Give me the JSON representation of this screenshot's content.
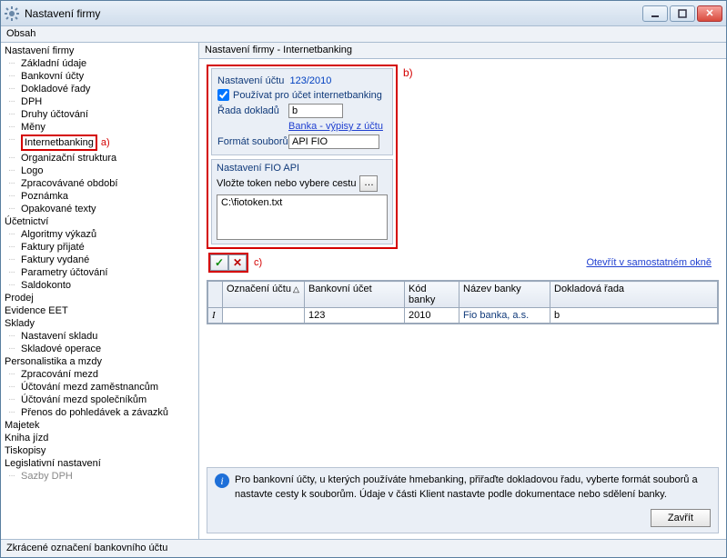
{
  "window": {
    "title": "Nastavení firmy"
  },
  "menu": {
    "obsah": "Obsah"
  },
  "breadcrumb": "Nastavení firmy - Internetbanking",
  "annotations": {
    "a": "a)",
    "b": "b)",
    "c": "c)"
  },
  "tree": {
    "root1": "Nastavení firmy",
    "r1": [
      "Základní údaje",
      "Bankovní účty",
      "Dokladové řady",
      "DPH",
      "Druhy účtování",
      "Měny",
      "Internetbanking",
      "Organizační struktura",
      "Logo",
      "Zpracovávané období",
      "Poznámka",
      "Opakované texty"
    ],
    "root2": "Účetnictví",
    "r2": [
      "Algoritmy výkazů",
      "Faktury přijaté",
      "Faktury vydané",
      "Parametry účtování",
      "Saldokonto"
    ],
    "root3": "Prodej",
    "root4": "Evidence EET",
    "root5": "Sklady",
    "r5": [
      "Nastavení skladu",
      "Skladové operace"
    ],
    "root6": "Personalistika a mzdy",
    "r6": [
      "Zpracování mezd",
      "Účtování mezd zaměstnancům",
      "Účtování mezd společníkům",
      "Přenos do pohledávek a závazků"
    ],
    "root7": "Majetek",
    "root8": "Kniha jízd",
    "root9": "Tiskopisy",
    "root10": "Legislativní nastavení",
    "r10_cut": "Sazby DPH"
  },
  "settings": {
    "grouptitle": "Nastavení účtu",
    "account": "123/2010",
    "chk_label": "Používat pro účet internetbanking",
    "rada_label": "Řada dokladů",
    "rada_value": "b",
    "banka_link": "Banka - výpisy z účtu",
    "format_label": "Formát souborů",
    "format_value": "API FIO"
  },
  "fio": {
    "title": "Nastavení FIO API",
    "hint": "Vložte token nebo vybere cestu",
    "path": "C:\\fiotoken.txt"
  },
  "openlink": "Otevřít v samostatném okně",
  "grid": {
    "headers": [
      "Označení účtu",
      "Bankovní účet",
      "Kód banky",
      "Název banky",
      "Dokladová řada"
    ],
    "row": [
      "",
      "123",
      "2010",
      "Fio banka, a.s.",
      "b"
    ]
  },
  "info": {
    "text": "Pro bankovní účty, u kterých používáte hmebanking, přiřaďte dokladovou řadu, vyberte formát souborů a nastavte cesty k souborům. Údaje v části Klient nastavte podle dokumentace nebo sdělení banky."
  },
  "buttons": {
    "close": "Zavřít"
  },
  "status": "Zkrácené označení bankovního účtu"
}
